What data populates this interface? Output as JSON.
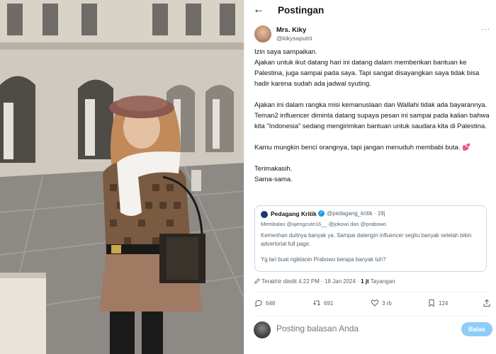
{
  "header": {
    "title": "Postingan",
    "back_icon": "←"
  },
  "post": {
    "author_name": "Mrs. Kiky",
    "author_handle": "@kikysaputrii",
    "more_icon": "···",
    "body": [
      "Izin saya sampaikan.",
      "Ajakan untuk ikut datang hari ini datang dalam memberikan bantuan ke Palestina, juga sampai pada saya. Tapi sangat disayangkan saya tidak bisa hadir karena sudah ada jadwal syuting.",
      "",
      "Ajakan ini dalam rangka misi kemanuslaan dan Wallahi tidak ada bayarannya.",
      "Teman2 influencer diminta datang supaya pesan ini sampai pada kalian bahwa kita \"Indonesia\" sedang mengirimkan bantuan untuk saudara kita di Palestina.",
      "",
      "Kamu mungkin benci orangnya, tapi jangan menuduh membabi buta.",
      "",
      "Terimakasih.",
      "Sama-sama."
    ],
    "heart_emoji": "💕",
    "meta_edited": "Terakhir diedit 4.22 PM · 18 Jan 2024 · ",
    "meta_views_count": "1 jt",
    "meta_views_label": " Tayangan"
  },
  "quote": {
    "name": "Pedagang Kritik",
    "verified_icon": "✓",
    "handle": "@pedagang_kritik · 19j",
    "reply_to": "Membalas @ajengcute16__ @jokowi dan @prabowo",
    "text1": "Kemenhan duitnya banyak ya. Sampai datengin influencer segitu banyak setelah bikin advertorial full page.",
    "text2": "Yg lari buat ngiklanin Prabowo berapa banyak tuh?"
  },
  "actions": {
    "replies": "648",
    "reposts": "691",
    "likes": "3 rb",
    "bookmarks": "124"
  },
  "reply": {
    "placeholder": "Posting balasan Anda",
    "button": "Balas"
  },
  "colors": {
    "accent": "#1d9bf0",
    "muted": "#536471",
    "button_disabled": "#8ecdf8"
  }
}
